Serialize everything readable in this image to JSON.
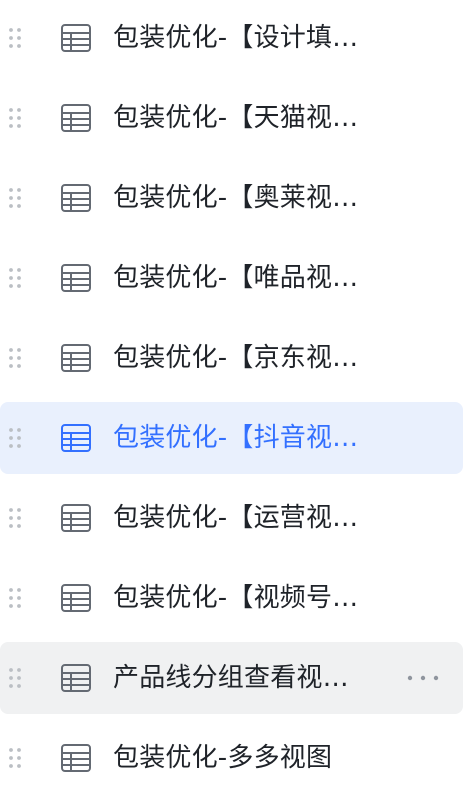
{
  "colors": {
    "text": "#1f2329",
    "icon": "#646a73",
    "drag": "#bbbfc4",
    "selected_text": "#3370ff",
    "selected_bg": "#e9f0fd",
    "hover_bg": "#f0f1f2"
  },
  "icons": {
    "drag": "drag-handle-icon",
    "row": "table-view-icon",
    "more": "more-icon"
  },
  "items": [
    {
      "label": "包装优化-【设计填…",
      "state": "normal"
    },
    {
      "label": "包装优化-【天猫视…",
      "state": "normal"
    },
    {
      "label": "包装优化-【奥莱视…",
      "state": "normal"
    },
    {
      "label": "包装优化-【唯品视…",
      "state": "normal"
    },
    {
      "label": "包装优化-【京东视…",
      "state": "normal"
    },
    {
      "label": "包装优化-【抖音视…",
      "state": "selected"
    },
    {
      "label": "包装优化-【运营视…",
      "state": "normal"
    },
    {
      "label": "包装优化-【视频号…",
      "state": "normal"
    },
    {
      "label": "产品线分组查看视…",
      "state": "hover"
    },
    {
      "label": "包装优化-多多视图",
      "state": "normal"
    }
  ]
}
